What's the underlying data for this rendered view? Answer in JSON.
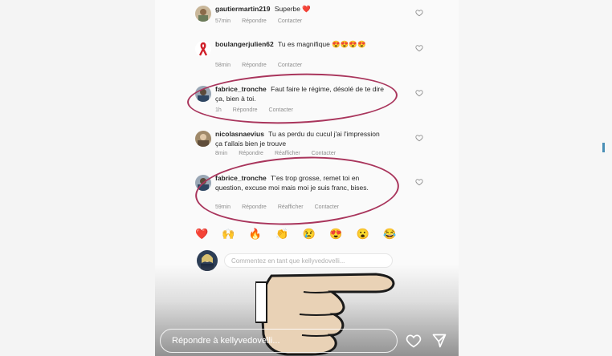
{
  "comments": [
    {
      "user": "gautiermartin219",
      "text": "Superbe ❤️",
      "time": "57min",
      "actions": [
        "Répondre",
        "Contacter"
      ]
    },
    {
      "user": "boulangerjulien62",
      "text": "Tu es magnifique 😍😍😍😍",
      "time": "58min",
      "actions": [
        "Répondre",
        "Contacter"
      ]
    },
    {
      "user": "fabrice_tronche",
      "text": "Faut faire le régime, désolé de te dire ça, bien à toi.",
      "time": "1h",
      "actions": [
        "Répondre",
        "Contacter"
      ]
    },
    {
      "user": "nicolasnaevius",
      "text": "Tu as perdu du cucul j'ai l'impression ça t'allais bien je trouve",
      "time": "8min",
      "actions": [
        "Répondre",
        "Réafficher",
        "Contacter"
      ]
    },
    {
      "user": "fabrice_tronche",
      "text": "T'es trop grosse, remet toi en question, excuse moi mais moi je suis franc, bises.",
      "time": "59min",
      "actions": [
        "Répondre",
        "Réafficher",
        "Contacter"
      ]
    }
  ],
  "reactions": [
    "❤️",
    "🙌",
    "🔥",
    "👏",
    "😢",
    "😍",
    "😮",
    "😂"
  ],
  "compose": {
    "placeholder": "Commentez en tant que kellyvedovelli..."
  },
  "story_reply": {
    "placeholder": "Répondre à kellyvedovelli..."
  },
  "colors": {
    "annotation_circle": "#a9355c",
    "text": "#262626",
    "meta": "#8e8e8e"
  }
}
